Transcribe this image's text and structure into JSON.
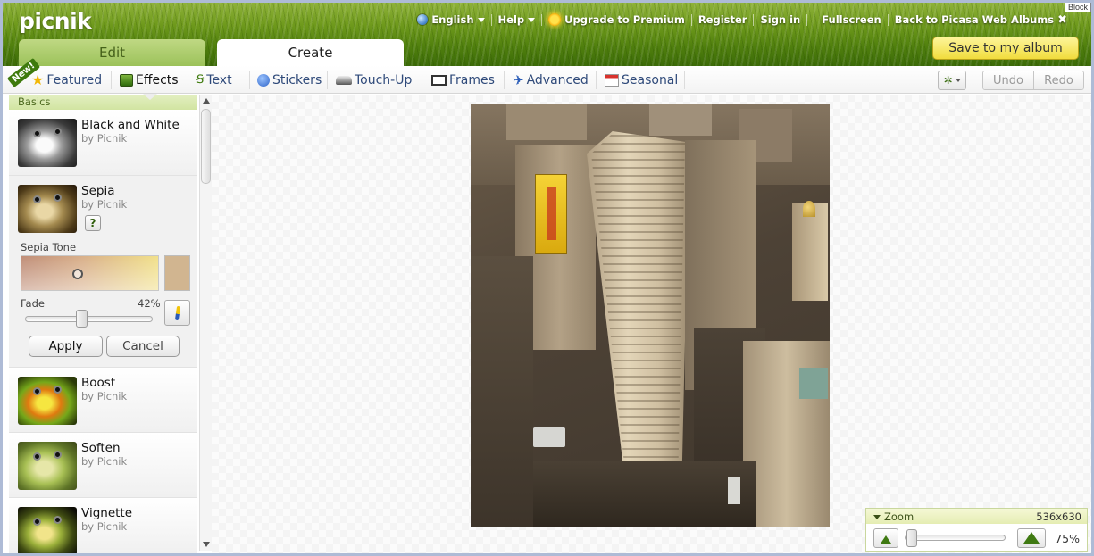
{
  "header": {
    "logo": "picnik",
    "block_badge": "Block",
    "nav": {
      "language": "English",
      "help": "Help",
      "upgrade": "Upgrade to Premium",
      "register": "Register",
      "sign_in": "Sign in",
      "fullscreen": "Fullscreen",
      "back": "Back to Picasa Web Albums"
    },
    "tabs": {
      "edit": "Edit",
      "create": "Create"
    },
    "save_button": "Save to my album"
  },
  "toolbar": {
    "new_badge": "New!",
    "tabs": [
      {
        "label": "Featured",
        "icon": "star-icon"
      },
      {
        "label": "Effects",
        "icon": "effects-icon",
        "active": true
      },
      {
        "label": "Text",
        "icon": "text-icon"
      },
      {
        "label": "Stickers",
        "icon": "stickers-icon"
      },
      {
        "label": "Touch-Up",
        "icon": "touchup-icon"
      },
      {
        "label": "Frames",
        "icon": "frames-icon"
      },
      {
        "label": "Advanced",
        "icon": "advanced-icon"
      },
      {
        "label": "Seasonal",
        "icon": "calendar-icon"
      }
    ],
    "undo": "Undo",
    "redo": "Redo"
  },
  "sidebar": {
    "category": "Basics",
    "effects": [
      {
        "name": "Black and White",
        "by": "by Picnik"
      },
      {
        "name": "Sepia",
        "by": "by Picnik"
      },
      {
        "name": "Boost",
        "by": "by Picnik"
      },
      {
        "name": "Soften",
        "by": "by Picnik"
      },
      {
        "name": "Vignette",
        "by": "by Picnik"
      }
    ],
    "sepia_panel": {
      "help": "?",
      "tone_label": "Sepia Tone",
      "fade_label": "Fade",
      "fade_value": "42%",
      "fade_fraction": 0.42,
      "apply": "Apply",
      "cancel": "Cancel",
      "tone_swatch_color": "#d1b590"
    }
  },
  "zoom": {
    "title": "Zoom",
    "dimensions": "536x630",
    "percent": "75%"
  },
  "colors": {
    "accent_green": "#3e7a0d",
    "save_yellow": "#f1dc3d",
    "toolbar_link": "#2f4a7a"
  }
}
